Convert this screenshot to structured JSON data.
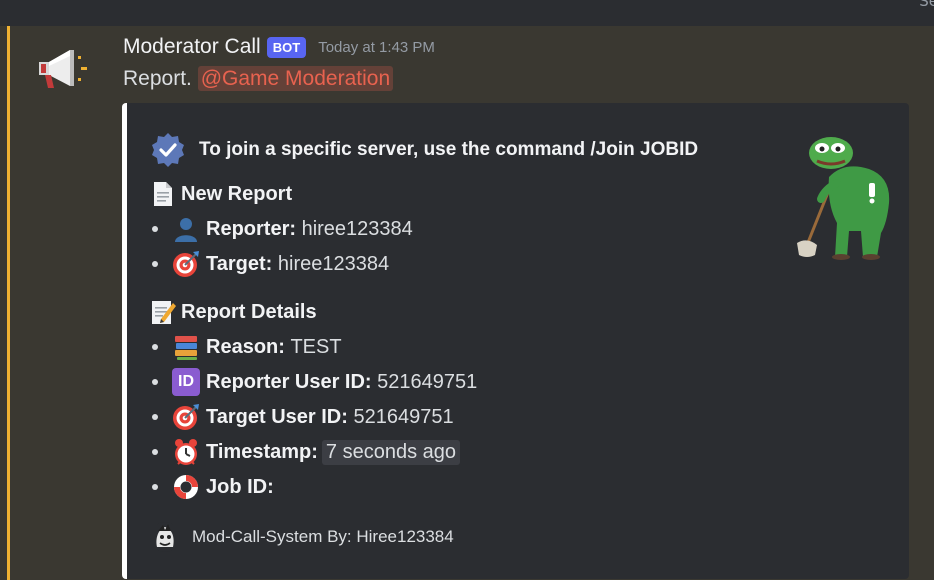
{
  "top_clip": "Se",
  "message": {
    "username": "Moderator Call",
    "bot_tag": "BOT",
    "timestamp": "Today at 1:43 PM",
    "content_text": "Report.",
    "mention": "@Game Moderation",
    "avatar_icon": "megaphone-icon"
  },
  "embed": {
    "accent_color": "#ffffff",
    "title_line": "To join a specific server, use the command /Join JOBID",
    "title_icon": "verified-check-icon",
    "new_report": {
      "heading": "New Report",
      "heading_icon": "document-icon",
      "items": [
        {
          "icon": "person-icon",
          "label": "Reporter:",
          "value": "hiree123384"
        },
        {
          "icon": "target-icon",
          "label": "Target:",
          "value": "hiree123384"
        }
      ]
    },
    "report_details": {
      "heading": "Report Details",
      "heading_icon": "memo-icon",
      "items": [
        {
          "icon": "books-icon",
          "label": "Reason:",
          "value": "TEST"
        },
        {
          "icon": "id-icon",
          "icon_text": "ID",
          "label": "Reporter User ID:",
          "value": "521649751"
        },
        {
          "icon": "target-icon",
          "label": "Target User ID:",
          "value": "521649751"
        },
        {
          "icon": "alarm-clock-icon",
          "label": "Timestamp:",
          "value": "7 seconds ago"
        },
        {
          "icon": "lifebuoy-icon",
          "label": "Job ID:",
          "value": ""
        }
      ]
    },
    "footer": {
      "text": "Mod-Call-System By: Hiree123384",
      "icon": "footer-avatar-icon"
    },
    "thumbnail_icon": "frog-janitor-icon"
  },
  "colors": {
    "bot_tag": "#5865f2",
    "mention": "#e8624f",
    "highlight_bar": "#f0b232",
    "embed_bg": "#2b2d31"
  }
}
